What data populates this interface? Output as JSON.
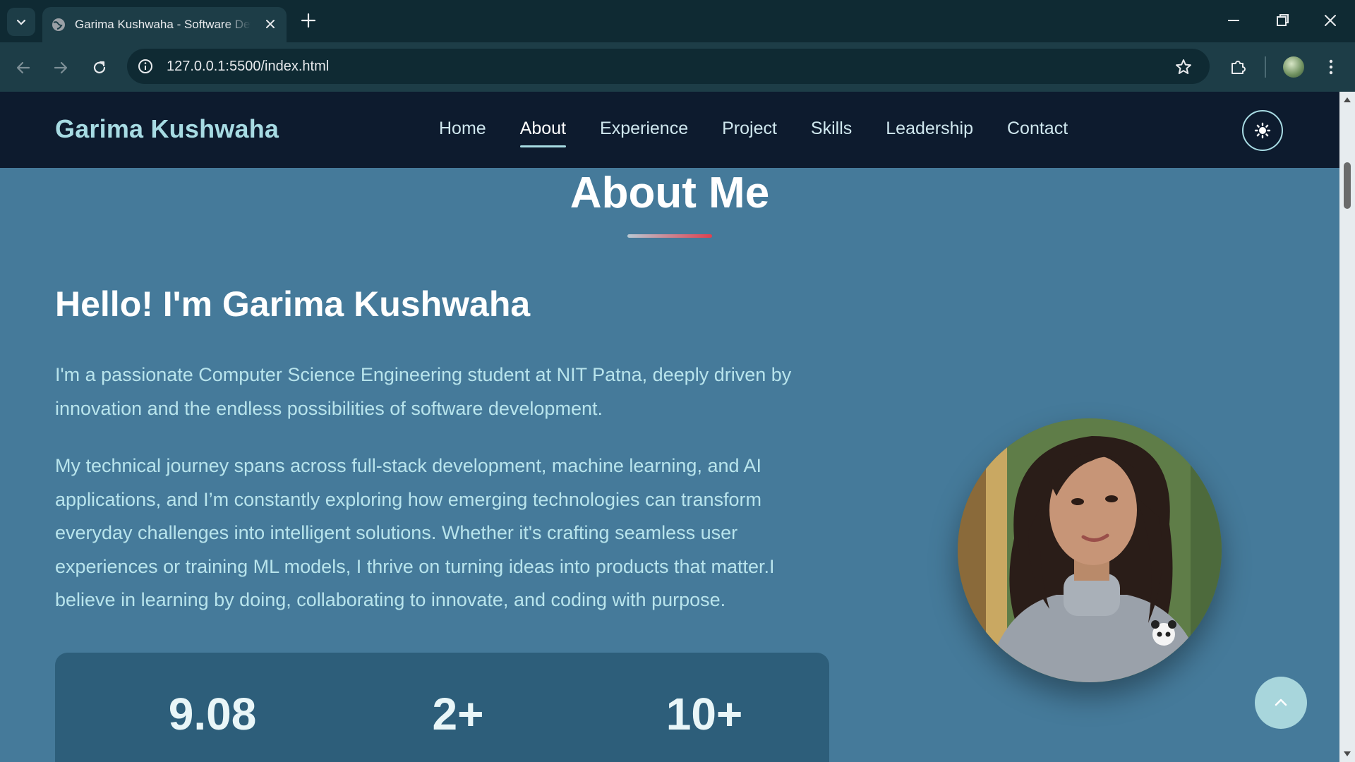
{
  "browser": {
    "tab_title": "Garima Kushwaha - Software Developer",
    "url": "127.0.0.1:5500/index.html"
  },
  "site": {
    "brand": "Garima Kushwaha",
    "nav": [
      "Home",
      "About",
      "Experience",
      "Project",
      "Skills",
      "Leadership",
      "Contact"
    ],
    "active_nav": "About"
  },
  "about": {
    "title": "About Me",
    "heading": "Hello! I'm Garima Kushwaha",
    "paragraph_1": "I'm a passionate Computer Science Engineering student at NIT Patna, deeply driven by innovation and the endless possibilities of software development.",
    "paragraph_2": "My technical journey spans across full-stack development, machine learning, and AI applications, and I’m constantly exploring how emerging technologies can transform everyday challenges into intelligent solutions. Whether it's crafting seamless user experiences or training ML models, I thrive on turning ideas into products that matter.I believe in learning by doing, collaborating to innovate, and coding with purpose.",
    "stats": [
      "9.08",
      "2+",
      "10+"
    ]
  },
  "colors": {
    "navbar_bg": "#0d1b2e",
    "page_bg": "#457a9a",
    "accent": "#a7dbe3",
    "underline_end": "#e0404f"
  },
  "icons": [
    "tab-search-icon",
    "globe-icon",
    "close-icon",
    "plus-icon",
    "minimize-icon",
    "restore-icon",
    "back-icon",
    "forward-icon",
    "reload-icon",
    "site-info-icon",
    "star-icon",
    "extensions-icon",
    "profile-avatar",
    "menu-icon",
    "sun-icon",
    "chevron-up-icon"
  ]
}
